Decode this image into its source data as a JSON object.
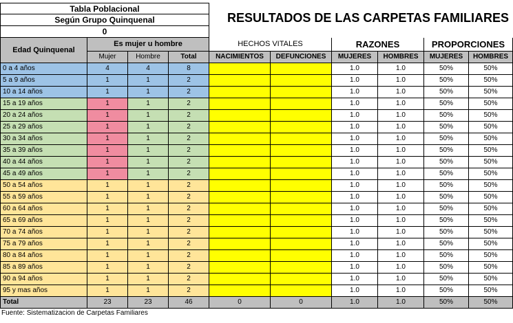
{
  "header": {
    "title1": "Tabla Poblacional",
    "title2": "Según Grupo Quinquenal",
    "title3": "0",
    "main_title": "RESULTADOS DE LAS CARPETAS FAMILIARES"
  },
  "columns": {
    "edad": "Edad Quinquenal",
    "es_mujer": "Es mujer u hombre",
    "mujer": "Mujer",
    "hombre": "Hombre",
    "total": "Total",
    "hechos": "HECHOS VITALES",
    "nacimientos": "NACIMIENTOS",
    "defunciones": "DEFUNCIONES",
    "razones": "RAZONES",
    "proporciones": "PROPORCIONES",
    "r_mujeres": "MUJERES",
    "r_hombres": "HOMBRES",
    "p_mujeres": "MUJERES",
    "p_hombres": "HOMBRES"
  },
  "rows": [
    {
      "edad": "0 a 4 años",
      "mujer": "4",
      "hombre": "4",
      "total": "8",
      "razon_m": "1.0",
      "razon_h": "1.0",
      "prop_m": "50%",
      "prop_h": "50%"
    },
    {
      "edad": "5 a 9 años",
      "mujer": "1",
      "hombre": "1",
      "total": "2",
      "razon_m": "1.0",
      "razon_h": "1.0",
      "prop_m": "50%",
      "prop_h": "50%"
    },
    {
      "edad": "10 a 14 años",
      "mujer": "1",
      "hombre": "1",
      "total": "2",
      "razon_m": "1.0",
      "razon_h": "1.0",
      "prop_m": "50%",
      "prop_h": "50%"
    },
    {
      "edad": "15 a 19 años",
      "mujer": "1",
      "hombre": "1",
      "total": "2",
      "razon_m": "1.0",
      "razon_h": "1.0",
      "prop_m": "50%",
      "prop_h": "50%"
    },
    {
      "edad": "20 a 24 años",
      "mujer": "1",
      "hombre": "1",
      "total": "2",
      "razon_m": "1.0",
      "razon_h": "1.0",
      "prop_m": "50%",
      "prop_h": "50%"
    },
    {
      "edad": "25 a 29 años",
      "mujer": "1",
      "hombre": "1",
      "total": "2",
      "razon_m": "1.0",
      "razon_h": "1.0",
      "prop_m": "50%",
      "prop_h": "50%"
    },
    {
      "edad": "30 a 34 años",
      "mujer": "1",
      "hombre": "1",
      "total": "2",
      "razon_m": "1.0",
      "razon_h": "1.0",
      "prop_m": "50%",
      "prop_h": "50%"
    },
    {
      "edad": "35 a 39 años",
      "mujer": "1",
      "hombre": "1",
      "total": "2",
      "razon_m": "1.0",
      "razon_h": "1.0",
      "prop_m": "50%",
      "prop_h": "50%"
    },
    {
      "edad": "40 a 44 años",
      "mujer": "1",
      "hombre": "1",
      "total": "2",
      "razon_m": "1.0",
      "razon_h": "1.0",
      "prop_m": "50%",
      "prop_h": "50%"
    },
    {
      "edad": "45 a 49 años",
      "mujer": "1",
      "hombre": "1",
      "total": "2",
      "razon_m": "1.0",
      "razon_h": "1.0",
      "prop_m": "50%",
      "prop_h": "50%"
    },
    {
      "edad": "50 a 54 años",
      "mujer": "1",
      "hombre": "1",
      "total": "2",
      "razon_m": "1.0",
      "razon_h": "1.0",
      "prop_m": "50%",
      "prop_h": "50%"
    },
    {
      "edad": "55 a 59 años",
      "mujer": "1",
      "hombre": "1",
      "total": "2",
      "razon_m": "1.0",
      "razon_h": "1.0",
      "prop_m": "50%",
      "prop_h": "50%"
    },
    {
      "edad": "60 a 64 años",
      "mujer": "1",
      "hombre": "1",
      "total": "2",
      "razon_m": "1.0",
      "razon_h": "1.0",
      "prop_m": "50%",
      "prop_h": "50%"
    },
    {
      "edad": "65 a 69 años",
      "mujer": "1",
      "hombre": "1",
      "total": "2",
      "razon_m": "1.0",
      "razon_h": "1.0",
      "prop_m": "50%",
      "prop_h": "50%"
    },
    {
      "edad": "70 a 74 años",
      "mujer": "1",
      "hombre": "1",
      "total": "2",
      "razon_m": "1.0",
      "razon_h": "1.0",
      "prop_m": "50%",
      "prop_h": "50%"
    },
    {
      "edad": "75 a 79 años",
      "mujer": "1",
      "hombre": "1",
      "total": "2",
      "razon_m": "1.0",
      "razon_h": "1.0",
      "prop_m": "50%",
      "prop_h": "50%"
    },
    {
      "edad": "80 a 84 años",
      "mujer": "1",
      "hombre": "1",
      "total": "2",
      "razon_m": "1.0",
      "razon_h": "1.0",
      "prop_m": "50%",
      "prop_h": "50%"
    },
    {
      "edad": "85 a 89 años",
      "mujer": "1",
      "hombre": "1",
      "total": "2",
      "razon_m": "1.0",
      "razon_h": "1.0",
      "prop_m": "50%",
      "prop_h": "50%"
    },
    {
      "edad": "90 a 94 años",
      "mujer": "1",
      "hombre": "1",
      "total": "2",
      "razon_m": "1.0",
      "razon_h": "1.0",
      "prop_m": "50%",
      "prop_h": "50%"
    },
    {
      "edad": "95 y mas años",
      "mujer": "1",
      "hombre": "1",
      "total": "2",
      "razon_m": "1.0",
      "razon_h": "1.0",
      "prop_m": "50%",
      "prop_h": "50%"
    }
  ],
  "totals": {
    "label": "Total",
    "mujer": "23",
    "hombre": "23",
    "total": "46",
    "nacimientos": "0",
    "defunciones": "0",
    "razon_m": "1.0",
    "razon_h": "1.0",
    "prop_m": "50%",
    "prop_h": "50%"
  },
  "footer": {
    "source": "Fuente: Sistematizacion de Carpetas Familiares"
  },
  "colors": {
    "header_gray": "#bfbfbf",
    "group_blue": "#9dc3e6",
    "group_green": "#c5dfb3",
    "group_orange": "#ffe599",
    "mujer_pink": "#f08ca0",
    "hechos_yellow": "#ffff00"
  }
}
